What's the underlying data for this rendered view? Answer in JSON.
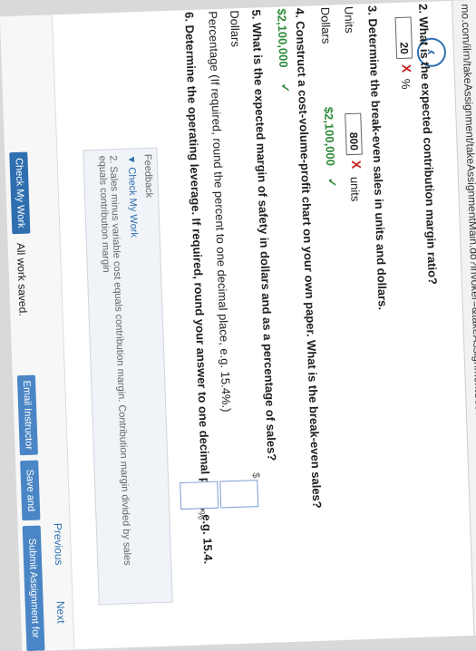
{
  "browser": {
    "url": "mo.com/ilrn/takeAssignment/takeAssignmentMain.do?invoker=&takeAssignmentSessionLocator=&inprogress=false"
  },
  "questions": {
    "q2": {
      "text": "2. What is the expected contribution margin ratio?",
      "value": "20",
      "mark": "X",
      "unit": "%"
    },
    "q3": {
      "text": "3. Determine the break-even sales in units and dollars.",
      "units_label": "Units",
      "units_value": "800",
      "units_mark": "X",
      "units_unit": "units",
      "dollars_label": "Dollars",
      "dollars_value": "$2,100,000",
      "dollars_mark": "✓"
    },
    "q4": {
      "text": "4. Construct a cost-volume-profit chart on your own paper. What is the break-even sales?",
      "value": "$2,100,000",
      "mark": "✓"
    },
    "q5": {
      "text": "5. What is the expected margin of safety in dollars and as a percentage of sales?",
      "dollars_label": "Dollars",
      "dollar_sign": "$",
      "percentage_label": "Percentage (If required, round the percent to one decimal place, e.g. 15.4%.)",
      "percent_sign": "%"
    },
    "q6": {
      "text": "6. Determine the operating leverage. If required, round your answer to one decimal place, e.g. 15.4."
    }
  },
  "feedback": {
    "title": "Feedback",
    "check_link": "▼ Check My Work",
    "hint": "2. Sales minus variable cost equals contribution margin. Contribution margin divided by sales equals contribution margin"
  },
  "footer": {
    "check_my_work": "Check My Work",
    "previous": "Previous",
    "next": "Next",
    "status": "All work saved.",
    "email_instructor": "Email Instructor",
    "save_and_exit": "Save and Exit",
    "submit": "Submit Assignment for Grading"
  },
  "icons": {
    "back": "chevron-left-icon",
    "star": "star-icon",
    "reader": "reader-icon"
  }
}
